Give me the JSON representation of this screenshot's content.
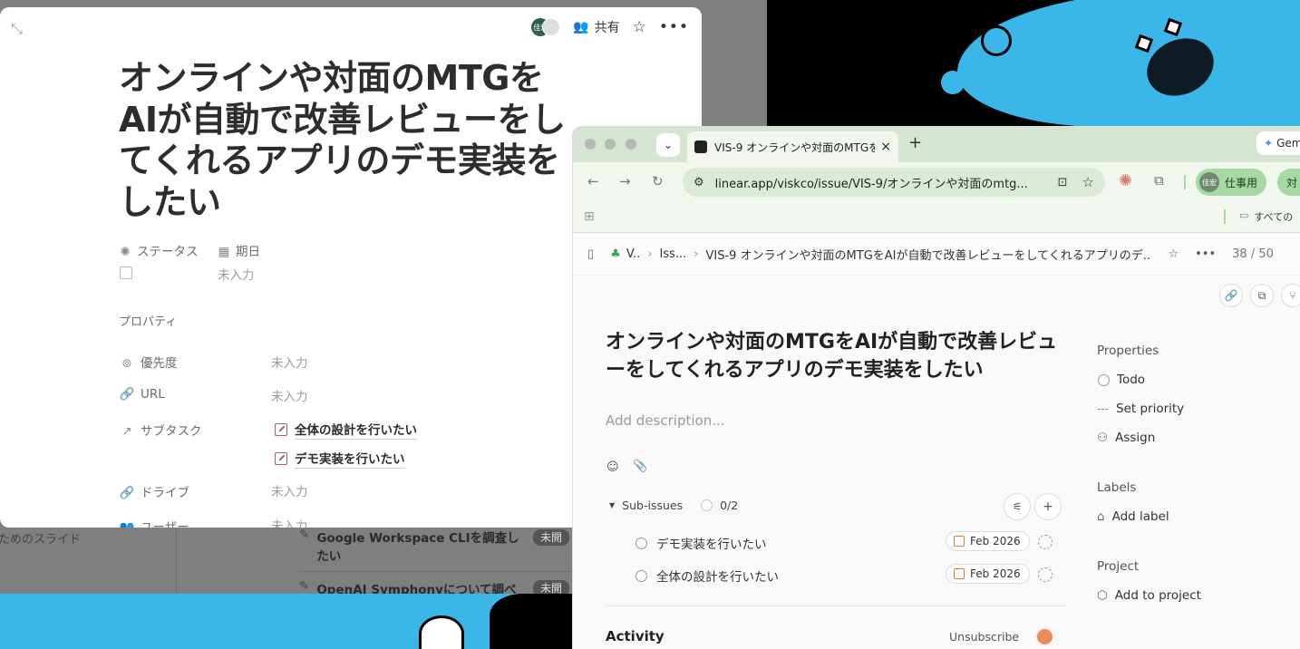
{
  "colors": {
    "accent_blue": "#3bb6e8",
    "chrome_green": "#d6e5d1",
    "pill_green": "#a6d9a3",
    "date_orange": "#e8773a"
  },
  "notion": {
    "avatar_initials": "佳宏",
    "share_label": "共有",
    "title": "オンラインや対面のMTGをAIが自動で改善レビューをしてくれるアプリのデモ実装をしたい",
    "status_label": "ステータス",
    "date_label": "期日",
    "date_value": "未入力",
    "properties_heading": "プロパティ",
    "props": [
      {
        "label": "優先度",
        "value": "未入力",
        "icon": "priority-icon"
      },
      {
        "label": "URL",
        "value": "未入力",
        "icon": "link-icon"
      },
      {
        "label": "サブタスク",
        "value": "",
        "icon": "arrow-up-right-icon"
      },
      {
        "label": "ドライブ",
        "value": "未入力",
        "icon": "link-icon"
      },
      {
        "label": "ユーザー",
        "value": "未入力",
        "icon": "users-icon"
      }
    ],
    "subtasks": [
      "全体の設計を行いたい",
      "デモ実装を行いたい"
    ]
  },
  "background_db": {
    "left_text": "ためのスライド",
    "rows": [
      {
        "title": "Google Workspace CLIを調査したい",
        "badge": "未開"
      },
      {
        "title": "OpenAI Symphonyについて調べ",
        "badge": "未開"
      }
    ]
  },
  "chrome": {
    "tab_title": "VIS-9 オンラインや対面のMTGを",
    "url": "linear.app/viskco/issue/VIS-9/オンラインや対面のmtg...",
    "profile_initials": "佳宏",
    "profile_label": "仕事用",
    "profile2_label": "対",
    "gemini_label": "Gem",
    "bookmark_folder": "すべての"
  },
  "linear": {
    "breadcrumb_team": "V..",
    "breadcrumb_section": "Iss...",
    "breadcrumb_issue": "VIS-9  オンラインや対面のMTGをAIが自動で改善レビューをしてくれるアプリのデ...",
    "counter": "38 / 50",
    "title": "オンラインや対面のMTGをAIが自動で改善レビューをしてくれるアプリのデモ実装をしたい",
    "description_placeholder": "Add description...",
    "subissues_label": "Sub-issues",
    "subissues_progress": "0/2",
    "subissues": [
      {
        "title": "デモ実装を行いたい",
        "date": "Feb 2026"
      },
      {
        "title": "全体の設計を行いたい",
        "date": "Feb 2026"
      }
    ],
    "activity_label": "Activity",
    "unsubscribe_label": "Unsubscribe",
    "properties_heading": "Properties",
    "status": "Todo",
    "priority": "Set priority",
    "assign": "Assign",
    "labels_heading": "Labels",
    "add_label": "Add label",
    "project_heading": "Project",
    "add_project": "Add to project"
  }
}
